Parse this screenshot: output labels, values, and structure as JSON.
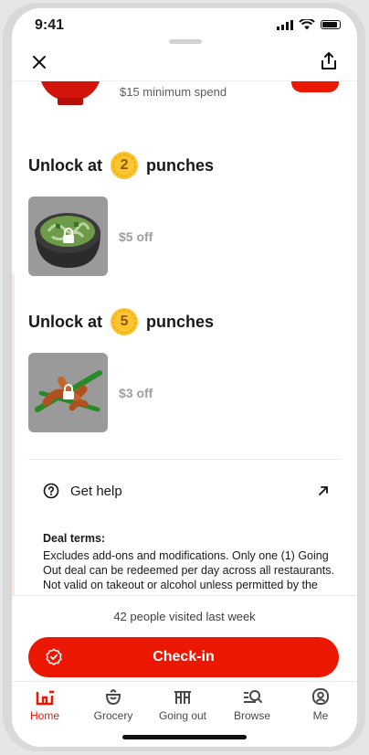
{
  "status_bar": {
    "time": "9:41"
  },
  "colors": {
    "brand": "#eb1700",
    "badge": "#fbc531",
    "badge_text": "#8b5a00"
  },
  "icons": {
    "close": "close-icon",
    "share": "share-icon",
    "help": "question-circle-icon",
    "external": "arrow-up-right-icon",
    "checkin": "checkmark-badge-icon"
  },
  "previous_tier": {
    "subtitle": "$15 minimum spend"
  },
  "tiers": [
    {
      "prefix": "Unlock at",
      "count": "2",
      "suffix": "punches",
      "reward": "$5 off",
      "image": "bowl-dish-image"
    },
    {
      "prefix": "Unlock at",
      "count": "5",
      "suffix": "punches",
      "reward": "$3 off",
      "image": "skewers-dish-image"
    }
  ],
  "help": {
    "label": "Get help"
  },
  "terms": {
    "title": "Deal terms:",
    "body": "Excludes add-ons and modifications. Only one (1) Going Out deal can be redeemed per day across all restaurants. Not valid on takeout or alcohol unless permitted by the restaurant."
  },
  "footer": {
    "visited": "42 people visited last week",
    "checkin_label": "Check-in"
  },
  "tabs": [
    {
      "label": "Home",
      "icon": "home-icon",
      "active": true
    },
    {
      "label": "Grocery",
      "icon": "grocery-icon",
      "active": false
    },
    {
      "label": "Going out",
      "icon": "going-out-icon",
      "active": false
    },
    {
      "label": "Browse",
      "icon": "browse-icon",
      "active": false
    },
    {
      "label": "Me",
      "icon": "profile-icon",
      "active": false
    }
  ]
}
